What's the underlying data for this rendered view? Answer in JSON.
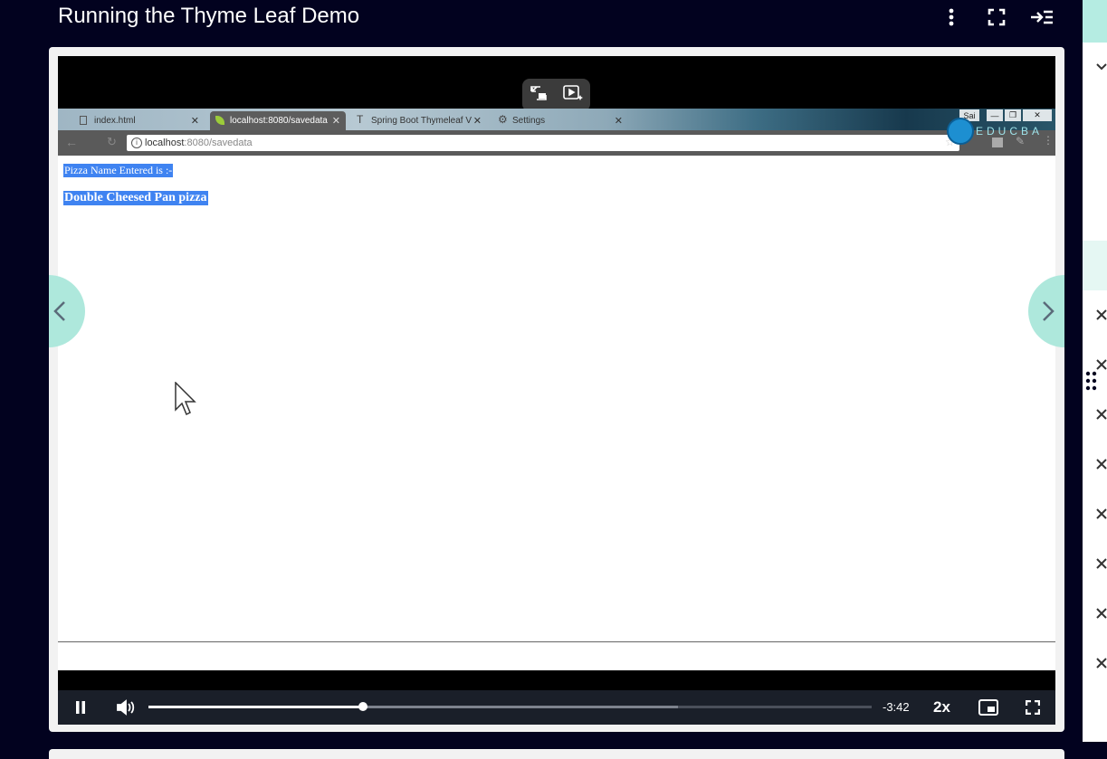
{
  "header": {
    "title": "Running the Thyme Leaf Demo",
    "icons": [
      "more-vertical-icon",
      "fullscreen-icon",
      "collapse-panel-icon"
    ]
  },
  "browser": {
    "tabs": [
      {
        "label": "index.html",
        "active": false
      },
      {
        "label": "localhost:8080/savedata",
        "active": true
      },
      {
        "label": "Spring Boot Thymeleaf V",
        "active": false
      },
      {
        "label": "Settings",
        "active": false
      }
    ],
    "window_user": "Sai",
    "url_host": "localhost",
    "url_path": ":8080/savedata",
    "logo_text": "EDUCBA"
  },
  "page": {
    "label": "Pizza Name Entered is :-",
    "value": "Double Cheesed Pan pizza"
  },
  "player": {
    "remaining": "-3:42",
    "speed": "2x",
    "progress_fraction": 0.296,
    "buffered_fraction": 0.732,
    "colors": {
      "accent": "#aee8dc",
      "background": "#02021f",
      "selection": "#3f83f1"
    }
  }
}
